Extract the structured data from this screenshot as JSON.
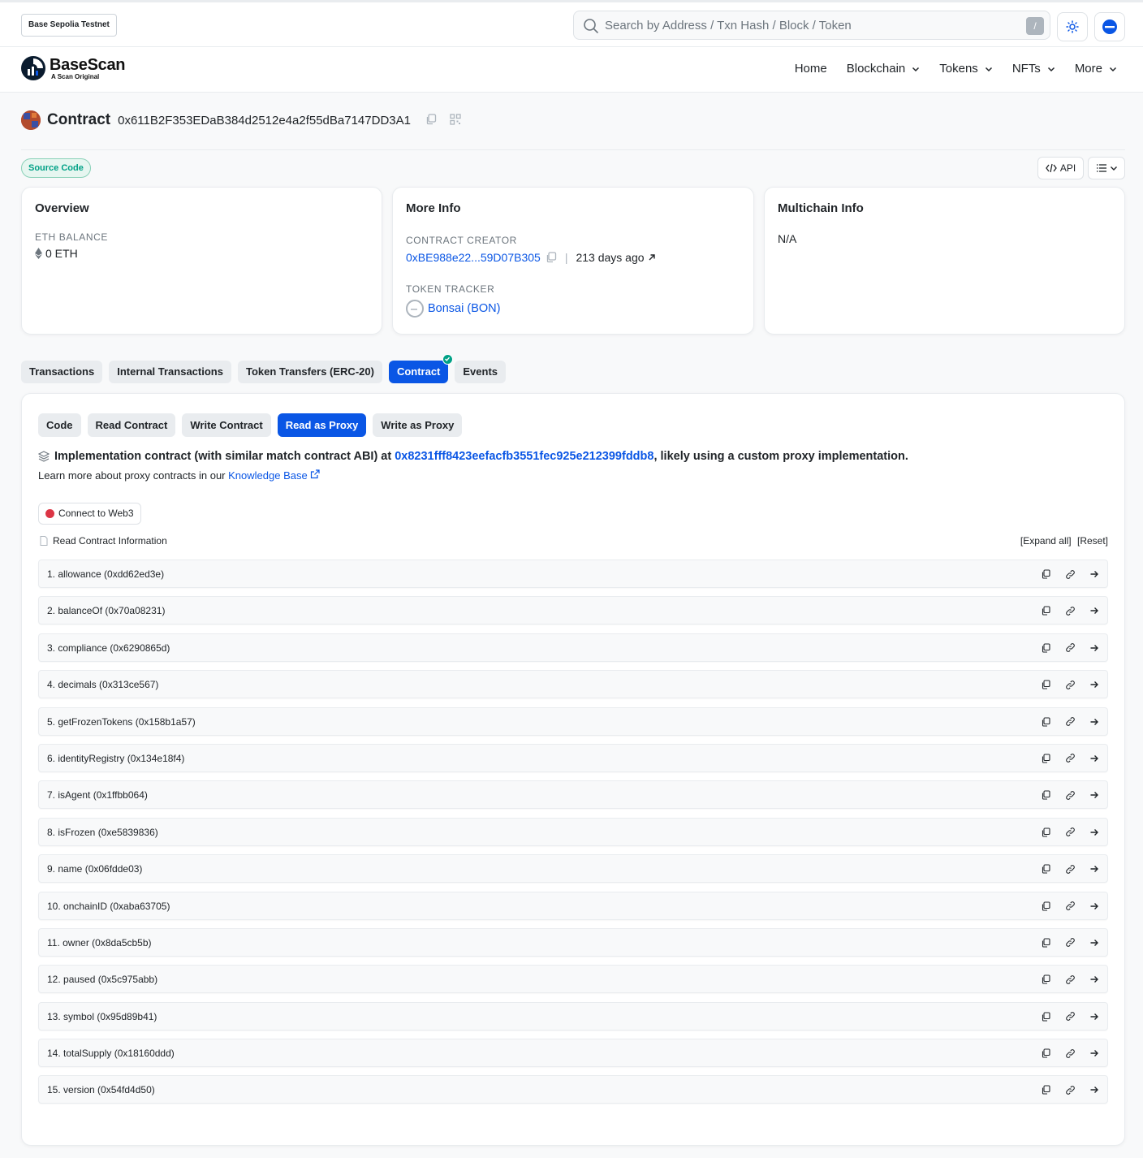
{
  "network": "Base Sepolia Testnet",
  "search": {
    "placeholder": "Search by Address / Txn Hash / Block / Token",
    "shortcut": "/"
  },
  "logo": {
    "title": "BaseScan",
    "subtitle": "A Scan Original"
  },
  "nav": {
    "items": [
      "Home",
      "Blockchain",
      "Tokens",
      "NFTs",
      "More"
    ]
  },
  "contract": {
    "title": "Contract",
    "address": "0x611B2F353EDaB384d2512e4a2f55dBa7147DD3A1"
  },
  "source_badge": "Source Code",
  "api_label": "API",
  "overview": {
    "title": "Overview",
    "balance_label": "ETH BALANCE",
    "balance_value": "0 ETH"
  },
  "more_info": {
    "title": "More Info",
    "creator_label": "CONTRACT CREATOR",
    "creator_address": "0xBE988e22...59D07B305",
    "creator_age": "213 days ago",
    "tracker_label": "TOKEN TRACKER",
    "tracker_value": "Bonsai (BON)"
  },
  "multichain": {
    "title": "Multichain Info",
    "value": "N/A"
  },
  "tabs": [
    "Transactions",
    "Internal Transactions",
    "Token Transfers (ERC-20)",
    "Contract",
    "Events"
  ],
  "subtabs": [
    "Code",
    "Read Contract",
    "Write Contract",
    "Read as Proxy",
    "Write as Proxy"
  ],
  "implementation": {
    "prefix": "Implementation contract (with similar match contract ABI) at",
    "address": "0x8231fff8423eefacfb3551fec925e212399fddb8",
    "suffix": ", likely using a custom proxy implementation.",
    "learn_text": "Learn more about proxy contracts in our",
    "learn_link": "Knowledge Base"
  },
  "connect_label": "Connect to Web3",
  "read_info_label": "Read Contract Information",
  "expand_all": "[Expand all]",
  "reset": "[Reset]",
  "functions": [
    "1. allowance (0xdd62ed3e)",
    "2. balanceOf (0x70a08231)",
    "3. compliance (0x6290865d)",
    "4. decimals (0x313ce567)",
    "5. getFrozenTokens (0x158b1a57)",
    "6. identityRegistry (0x134e18f4)",
    "7. isAgent (0x1ffbb064)",
    "8. isFrozen (0xe5839836)",
    "9. name (0x06fdde03)",
    "10. onchainID (0xaba63705)",
    "11. owner (0x8da5cb5b)",
    "12. paused (0x5c975abb)",
    "13. symbol (0x95d89b41)",
    "14. totalSupply (0x18160ddd)",
    "15. version (0x54fd4d50)"
  ],
  "colors": {
    "primary": "#0a56e5",
    "success": "#00a186",
    "danger": "#dc3545"
  }
}
